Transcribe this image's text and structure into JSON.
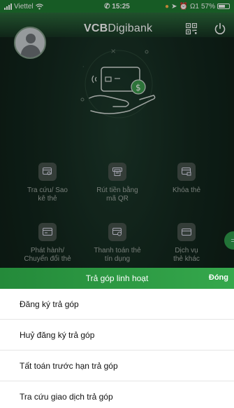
{
  "status_bar": {
    "carrier": "Viettel",
    "time": "15:25",
    "signal_right": "Ω1",
    "battery": "57%"
  },
  "header": {
    "brand_bold": "VCB",
    "brand_light": "Digibank"
  },
  "grid": {
    "items": [
      {
        "label_line1": "Tra cứu/ Sao",
        "label_line2": "kê thẻ",
        "icon": "card-search-icon"
      },
      {
        "label_line1": "Rút tiền bằng",
        "label_line2": "mã QR",
        "icon": "qr-withdraw-icon"
      },
      {
        "label_line1": "Khóa thẻ",
        "label_line2": "",
        "icon": "card-lock-icon"
      },
      {
        "label_line1": "Phát hành/",
        "label_line2": "Chuyển đổi thẻ",
        "icon": "card-issue-icon"
      },
      {
        "label_line1": "Thanh toán thẻ",
        "label_line2": "tín dụng",
        "icon": "card-pay-icon"
      },
      {
        "label_line1": "Dịch vụ",
        "label_line2": "thẻ khác",
        "icon": "card-other-icon"
      }
    ]
  },
  "sheet": {
    "title": "Trả góp linh hoạt",
    "close": "Đóng",
    "options": [
      "Đăng ký trả góp",
      "Huỷ đăng ký trả góp",
      "Tất toán trước hạn trả góp",
      "Tra cứu giao dịch trả góp"
    ]
  },
  "colors": {
    "accent": "#2e9a4a",
    "status_green": "#1f7a32",
    "background_dark": "#13281e"
  }
}
